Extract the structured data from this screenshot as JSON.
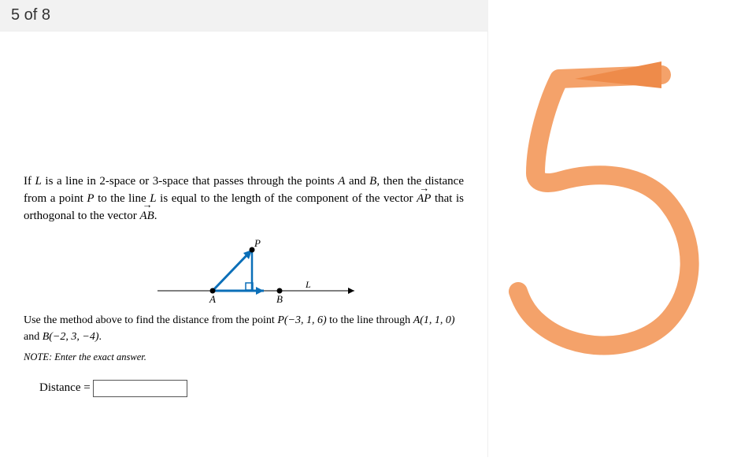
{
  "header": {
    "progress": "5 of 8"
  },
  "question": {
    "intro_part1": "If ",
    "L": "L",
    "intro_part2": " is a line in 2-space or 3-space that passes through the points ",
    "A": "A",
    "and": " and ",
    "B": "B",
    "intro_part3": ", then the distance from a point ",
    "P": "P",
    "intro_part4": " to the line ",
    "intro_part5": " is equal to the length of the component of the vector ",
    "vec_AP": "AP",
    "intro_part6": " that is orthogonal to the vector ",
    "vec_AB": "AB",
    "period": ".",
    "use_method_1": "Use the method above to find the distance from the point ",
    "point_P": "P(−3, 1, 6)",
    "use_method_2": " to the line through ",
    "point_A": "A(1, 1, 0)",
    "use_method_3": " and ",
    "point_B": "B(−2, 3, −4)",
    "note": "NOTE: Enter the exact answer.",
    "answer_label": "Distance = ",
    "answer_value": "",
    "diagram_labels": {
      "A": "A",
      "B": "B",
      "P": "P",
      "L": "L"
    }
  }
}
